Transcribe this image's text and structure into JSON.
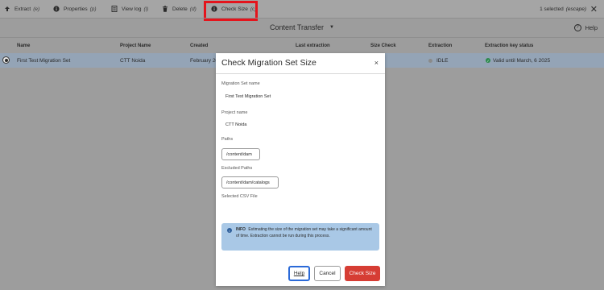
{
  "actionbar": {
    "extract": {
      "label": "Extract",
      "kbd": "(e)",
      "icon": "upload-icon"
    },
    "properties": {
      "label": "Properties",
      "kbd": "(p)",
      "icon": "info-icon"
    },
    "view_log": {
      "label": "View log",
      "kbd": "(l)",
      "icon": "log-icon"
    },
    "delete": {
      "label": "Delete",
      "kbd": "(d)",
      "icon": "trash-icon"
    },
    "check_size": {
      "label": "Check Size",
      "kbd": "(c)",
      "icon": "info-icon"
    },
    "selection_status": "1 selected",
    "selection_kbd": "(escape)",
    "close": "✕"
  },
  "header": {
    "title": "Content Transfer",
    "help": "Help"
  },
  "table": {
    "columns": {
      "name": "Name",
      "project": "Project Name",
      "created": "Created",
      "last_extraction": "Last extraction",
      "size_check": "Size Check",
      "extraction": "Extraction",
      "key_status": "Extraction key status"
    },
    "row": {
      "name": "First Test Migration Set",
      "project": "CTT Noida",
      "created": "February 20",
      "extraction": "IDLE",
      "key_status": "Valid until March, 6 2025"
    }
  },
  "dialog": {
    "title": "Check Migration Set Size",
    "close": "×",
    "migration_set_label": "Migration Set name",
    "migration_set_value": "First Test Migration Set",
    "project_label": "Project name",
    "project_value": "CTT Noida",
    "paths_label": "Paths",
    "paths_value": "/content/dam",
    "excluded_label": "Excluded Paths",
    "excluded_value": "/content/dam/catalogs",
    "csv_label": "Selected CSV File",
    "info_title": "INFO",
    "info_text": "Estimating the size of the migration set may take a significant amount of time. Extraction cannot be run during this process.",
    "buttons": {
      "help": "Help",
      "cancel": "Cancel",
      "check_size": "Check Size"
    }
  },
  "colors": {
    "highlight": "#e4141c",
    "primary_button": "#d63d34",
    "info_background": "#a9c8e6",
    "selected_row": "#94a4b6",
    "valid_status": "#2d8a4e"
  }
}
